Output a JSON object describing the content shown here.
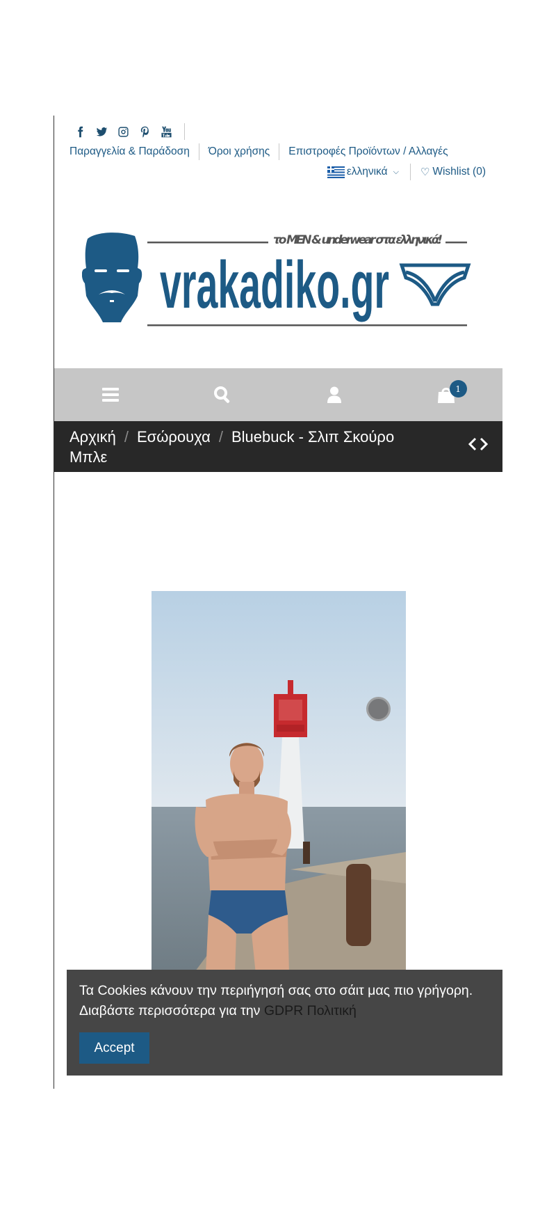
{
  "header": {
    "social_icons": [
      "facebook-icon",
      "twitter-icon",
      "instagram-icon",
      "pinterest-icon",
      "youtube-icon"
    ],
    "info_links": [
      "Παραγγελία & Παράδοση",
      "Όροι χρήσης",
      "Επιστροφές Προϊόντων / Αλλαγές"
    ],
    "language": "ελληνικά",
    "wishlist": "Wishlist (0)"
  },
  "logo": {
    "tagline": "το MEN & underwear στα ελληνικά!",
    "name": "vrakadiko.gr"
  },
  "nav": {
    "icons": [
      "menu-icon",
      "search-icon",
      "user-icon",
      "cart-icon"
    ],
    "cart_count": "1"
  },
  "breadcrumb": {
    "items": [
      "Αρχική",
      "Εσώρουχα",
      "Bluebuck - Σλιπ Σκούρο Μπλε"
    ]
  },
  "cookie": {
    "text": "Τα Cookies κάνουν την περιήγησή σας στο σάιτ μας πιο γρήγορη. Διαβάστε περισσότερα για την ",
    "link": "GDPR Πολιτική",
    "accept": "Accept"
  },
  "colors": {
    "brand": "#1d5a85",
    "navbar": "#c6c6c6",
    "breadcrumb_bg": "#282828",
    "cookie_bg": "#464646"
  }
}
